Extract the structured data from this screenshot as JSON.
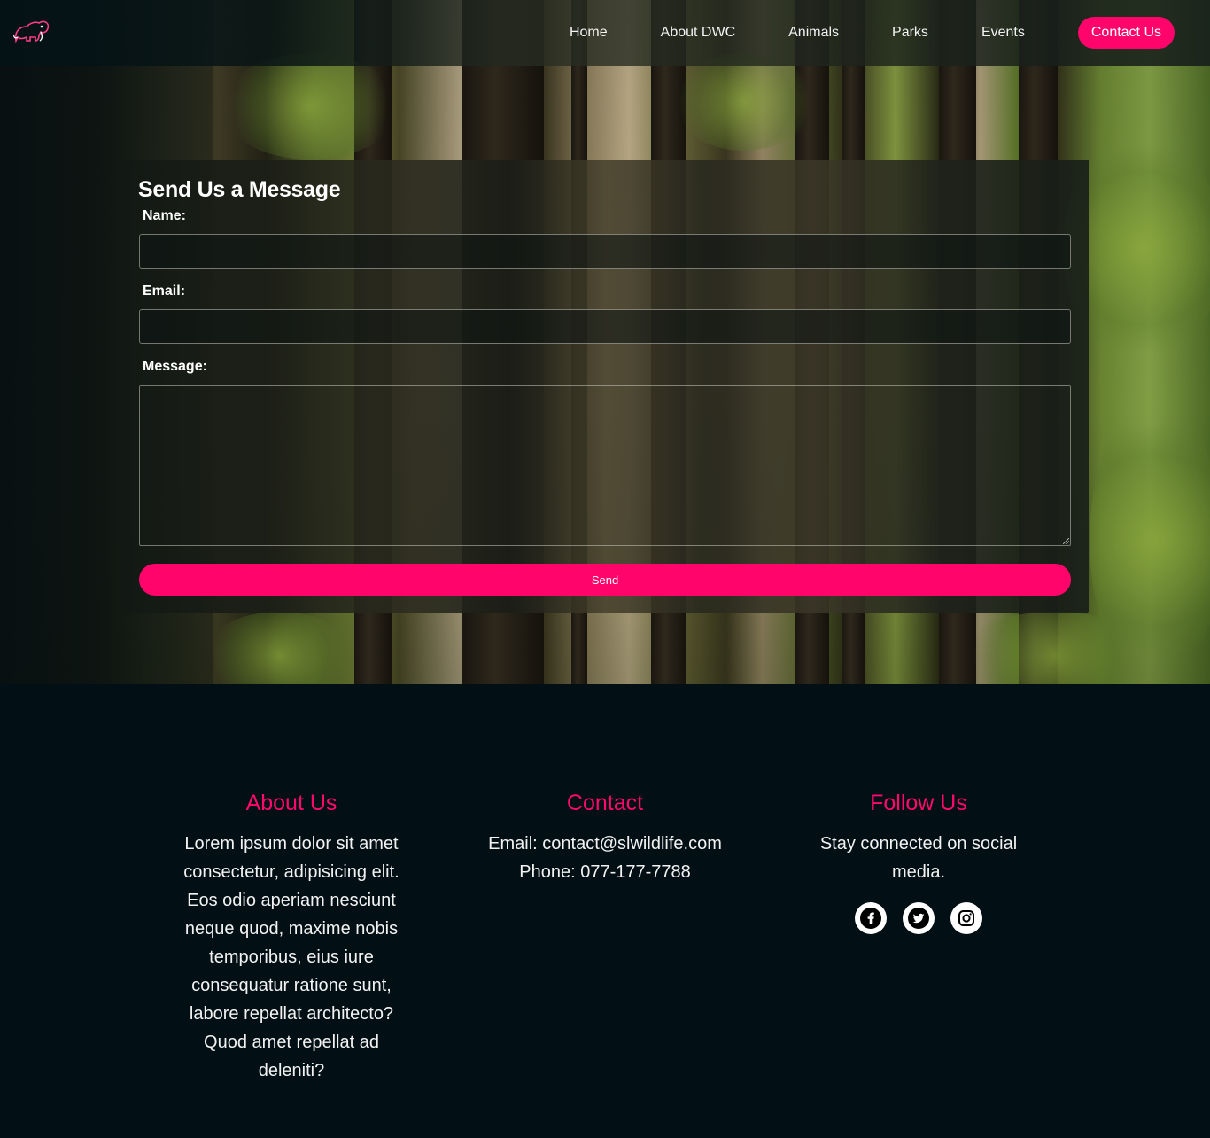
{
  "nav": {
    "logo_name": "elephant-logo",
    "links": [
      "Home",
      "About DWC",
      "Animals",
      "Parks",
      "Events"
    ],
    "cta": "Contact Us",
    "accent_color": "#ff056b"
  },
  "form": {
    "title": "Send Us a Message",
    "name_label": "Name:",
    "name_value": "",
    "email_label": "Email:",
    "email_value": "",
    "message_label": "Message:",
    "message_value": "",
    "send_label": "Send"
  },
  "footer": {
    "about": {
      "heading": "About Us",
      "text": "Lorem ipsum dolor sit amet consectetur, adipisicing elit. Eos odio aperiam nesciunt neque quod, maxime nobis temporibus, eius iure consequatur ratione sunt, labore repellat architecto? Quod amet repellat ad deleniti?"
    },
    "contact": {
      "heading": "Contact",
      "email_line": "Email: contact@slwildlife.com",
      "phone_line": "Phone: 077-177-7788"
    },
    "follow": {
      "heading": "Follow Us",
      "text": "Stay connected on social media.",
      "icons": [
        "facebook-icon",
        "twitter-icon",
        "instagram-icon"
      ]
    },
    "heading_color": "#ff0a6c",
    "background_color": "#020f14"
  }
}
